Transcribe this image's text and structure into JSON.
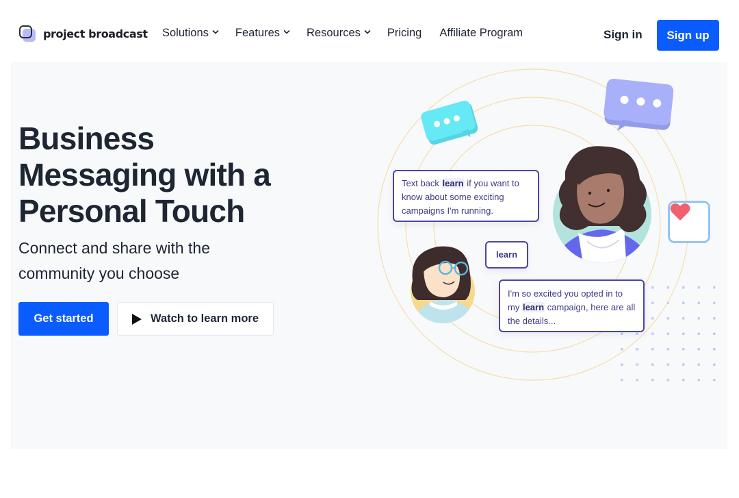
{
  "nav": {
    "brand": "project broadcast",
    "links": [
      {
        "label": "Solutions",
        "has_dropdown": true
      },
      {
        "label": "Features",
        "has_dropdown": true
      },
      {
        "label": "Resources",
        "has_dropdown": true
      },
      {
        "label": "Pricing",
        "has_dropdown": false
      },
      {
        "label": "Affiliate Program",
        "has_dropdown": false
      }
    ],
    "sign_in": "Sign in",
    "sign_up": "Sign up"
  },
  "hero": {
    "headline_lines": [
      "Business",
      "Messaging with a",
      "Personal Touch"
    ],
    "subhead_lines": [
      "Connect and share with the",
      "community you choose"
    ],
    "primary_cta": "Get started",
    "secondary_cta": "Watch to learn more",
    "secondary_icon": "play-icon"
  },
  "illustration": {
    "message_1": {
      "before": "Text back ",
      "keyword": "learn",
      "after": " if you want to know about some exciting campaigns I'm running."
    },
    "message_2": {
      "keyword": "learn"
    },
    "message_3": {
      "before": "I'm so excited you opted in to my ",
      "keyword": "learn",
      "after": " campaign, here are all the details..."
    },
    "icons": [
      "typing-bubble-icon",
      "typing-bubble-icon",
      "heart-icon",
      "avatar-woman-curly-hair",
      "avatar-woman-glasses"
    ]
  },
  "colors": {
    "brand_blue": "#0b5cff",
    "text_dark": "#1e2533",
    "hero_bg": "#f8f9fb",
    "message_border": "#4b44a8",
    "bubble_cyan": "#5ee4f4",
    "bubble_lavender": "#a3acf7",
    "heart": "#f0606e"
  }
}
